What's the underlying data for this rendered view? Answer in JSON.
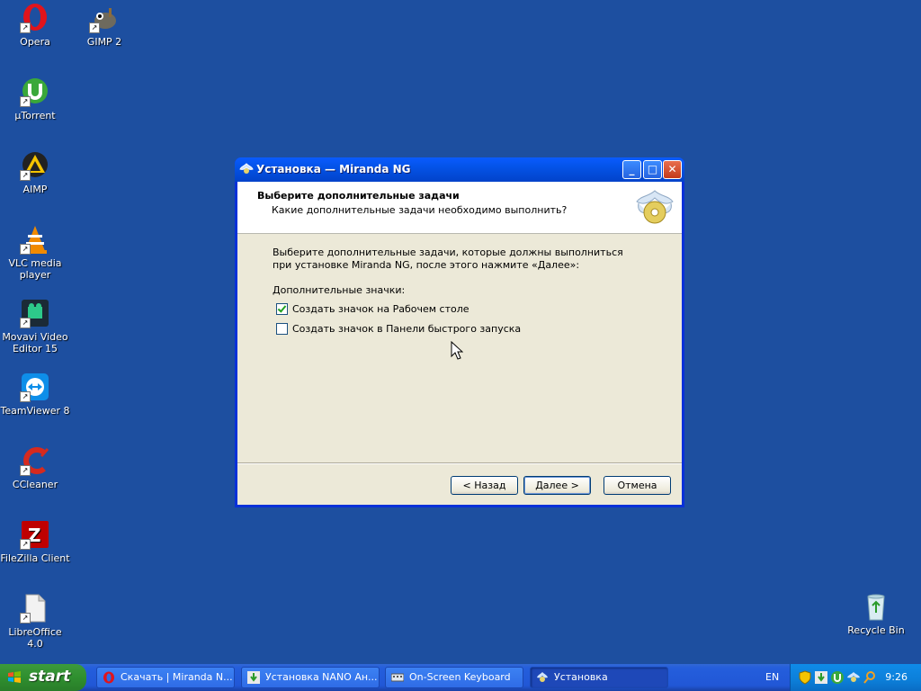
{
  "desktop": {
    "icons": [
      {
        "label": "Opera",
        "icon": "opera-icon"
      },
      {
        "label": "GIMP 2",
        "icon": "gimp-icon"
      },
      {
        "label": "µTorrent",
        "icon": "utorrent-icon"
      },
      {
        "label": "AIMP",
        "icon": "aimp-icon"
      },
      {
        "label": "VLC media player",
        "icon": "vlc-icon"
      },
      {
        "label": "Movavi Video Editor 15",
        "icon": "movavi-icon"
      },
      {
        "label": "TeamViewer 8",
        "icon": "teamviewer-icon"
      },
      {
        "label": "CCleaner",
        "icon": "ccleaner-icon"
      },
      {
        "label": "FileZilla Client",
        "icon": "filezilla-icon"
      },
      {
        "label": "LibreOffice 4.0",
        "icon": "libreoffice-icon"
      },
      {
        "label": "Recycle Bin",
        "icon": "recycle-bin-icon"
      }
    ],
    "background_color": "#1d4fa0"
  },
  "dialog": {
    "title": "Установка — Miranda NG",
    "header_title": "Выберите дополнительные задачи",
    "header_subtitle": "Какие дополнительные задачи необходимо выполнить?",
    "description": "Выберите дополнительные задачи, которые должны выполниться при установке Miranda NG, после этого нажмите «Далее»:",
    "group_label": "Дополнительные значки:",
    "options": [
      {
        "label": "Создать значок на Рабочем столе",
        "checked": true
      },
      {
        "label": "Создать значок в Панели быстрого запуска",
        "checked": false
      }
    ],
    "buttons": {
      "back": "< Назад",
      "next": "Далее >",
      "cancel": "Отмена"
    },
    "controls": {
      "minimize": "_",
      "maximize": "□",
      "close": "✕"
    }
  },
  "taskbar": {
    "start_label": "start",
    "tasks": [
      {
        "label": "Скачать | Miranda N...",
        "icon": "opera-icon",
        "active": false
      },
      {
        "label": "Установка NANO Ан...",
        "icon": "download-icon",
        "active": false
      },
      {
        "label": "On-Screen Keyboard",
        "icon": "keyboard-icon",
        "active": false
      },
      {
        "label": "Установка",
        "icon": "miranda-icon",
        "active": true
      }
    ],
    "language": "EN",
    "clock": "9:26"
  }
}
